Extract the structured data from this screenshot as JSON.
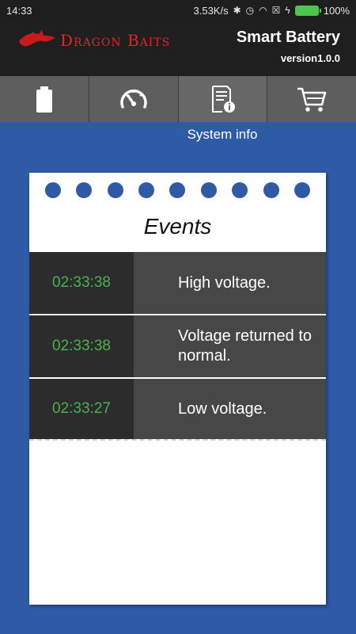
{
  "status": {
    "time": "14:33",
    "speed": "3.53K/s",
    "battery_pct": "100%"
  },
  "header": {
    "logo_text": "Dragon Baits",
    "title": "Smart Battery",
    "version": "version1.0.0"
  },
  "tabs": {
    "items": [
      {
        "icon": "battery-icon"
      },
      {
        "icon": "speedometer-icon"
      },
      {
        "icon": "system-info-icon"
      },
      {
        "icon": "shopping-cart-icon"
      }
    ],
    "active_label": "System info"
  },
  "events": {
    "title": "Events",
    "rows": [
      {
        "time": "02:33:38",
        "message": "High voltage."
      },
      {
        "time": "02:33:38",
        "message": "Voltage returned to normal."
      },
      {
        "time": "02:33:27",
        "message": "Low voltage."
      }
    ]
  },
  "colors": {
    "background": "#2f5aa6",
    "time_text": "#4caf50",
    "logo_red": "#e0242a"
  }
}
